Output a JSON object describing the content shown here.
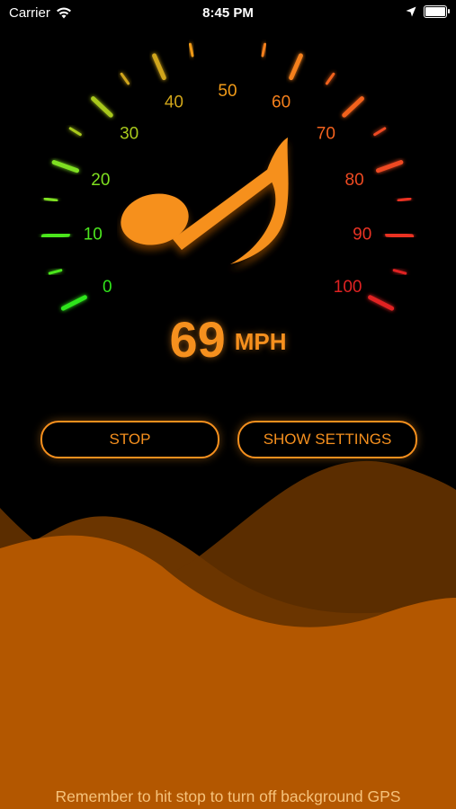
{
  "status_bar": {
    "carrier": "Carrier",
    "time": "8:45 PM",
    "icons": [
      "wifi-icon",
      "location-arrow-icon",
      "battery-icon"
    ]
  },
  "gauge": {
    "labels": [
      "0",
      "10",
      "20",
      "30",
      "40",
      "50",
      "60",
      "70",
      "80",
      "90",
      "100"
    ],
    "label_colors": [
      "#2fe51a",
      "#4ce61f",
      "#7fe020",
      "#a8c81c",
      "#d0a51a",
      "#f09a18",
      "#f5801c",
      "#f2621e",
      "#ee4a22",
      "#ea3324",
      "#e02222"
    ]
  },
  "speed": {
    "value": "69",
    "unit": "MPH"
  },
  "buttons": {
    "stop": "STOP",
    "settings": "SHOW SETTINGS"
  },
  "footer": "Remember to hit stop to turn off background GPS",
  "colors": {
    "accent": "#f6901e",
    "wave_back": "#6b3500",
    "wave_front": "#b35700"
  }
}
